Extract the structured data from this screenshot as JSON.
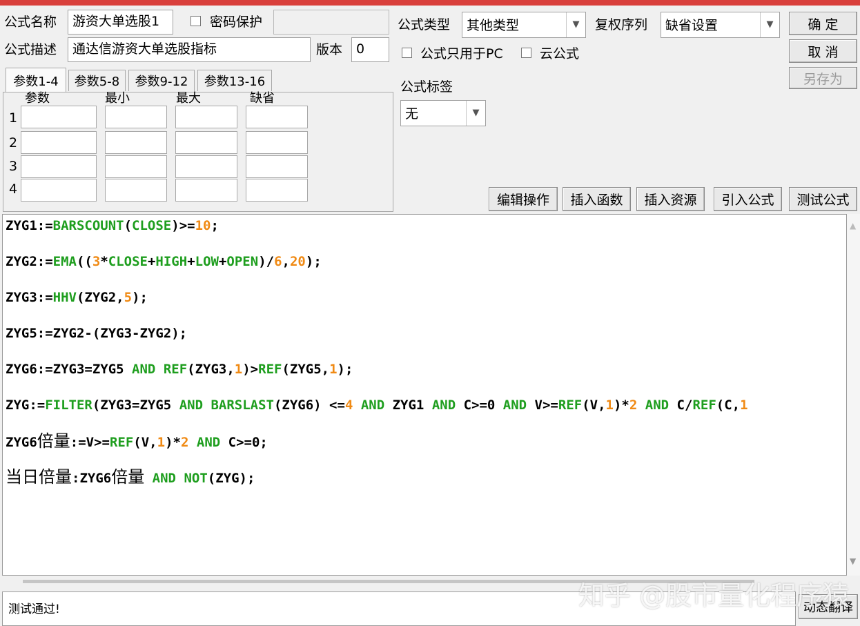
{
  "header": {
    "name_label": "公式名称",
    "name_value": "游资大单选股1",
    "password_label": "密码保护",
    "desc_label": "公式描述",
    "desc_value": "通达信游资大单选股指标",
    "version_label": "版本",
    "version_value": "0",
    "type_label": "公式类型",
    "type_value": "其他类型",
    "rights_label": "复权序列",
    "rights_value": "缺省设置",
    "pc_only_label": "公式只用于PC",
    "cloud_label": "云公式",
    "tag_label": "公式标签",
    "tag_value": "无"
  },
  "buttons": {
    "ok": "确 定",
    "cancel": "取 消",
    "save_as": "另存为",
    "edit_ops": "编辑操作",
    "insert_func": "插入函数",
    "insert_res": "插入资源",
    "import_formula": "引入公式",
    "test_formula": "测试公式",
    "dynamic_translate": "动态翻译"
  },
  "params": {
    "tabs": [
      "参数1-4",
      "参数5-8",
      "参数9-12",
      "参数13-16"
    ],
    "columns": [
      "参数",
      "最小",
      "最大",
      "缺省"
    ],
    "rows": [
      "1",
      "2",
      "3",
      "4"
    ]
  },
  "code": {
    "l1": {
      "a": "ZYG1:=",
      "b": "BARSCOUNT",
      "c": "(",
      "d": "CLOSE",
      "e": ")>=",
      "f": "10",
      "g": ";"
    },
    "l2": {
      "a": "ZYG2:=",
      "b": "EMA",
      "c": "((",
      "d": "3",
      "e": "*",
      "f": "CLOSE",
      "g": "+",
      "h": "HIGH",
      "i": "+",
      "j": "LOW",
      "k": "+",
      "l": "OPEN",
      "m": ")/",
      "n": "6",
      "o": ",",
      "p": "20",
      "q": ");"
    },
    "l3": {
      "a": "ZYG3:=",
      "b": "HHV",
      "c": "(ZYG2,",
      "d": "5",
      "e": ");"
    },
    "l4": {
      "a": "ZYG5:=ZYG2-(ZYG3-ZYG2);"
    },
    "l5": {
      "a": "ZYG6:=ZYG3=ZYG5 ",
      "b": "AND",
      "c": " ",
      "d": "REF",
      "e": "(ZYG3,",
      "f": "1",
      "g": ")>",
      "h": "REF",
      "i": "(ZYG5,",
      "j": "1",
      "k": ");"
    },
    "l6": {
      "a": "ZYG:=",
      "b": "FILTER",
      "c": "(ZYG3=ZYG5 ",
      "d": "AND",
      "e": " ",
      "f": "BARSLAST",
      "g": "(ZYG6) <=",
      "h": "4",
      "i": " ",
      "j": "AND",
      "k": " ZYG1 ",
      "l": "AND",
      "m": " C>=0 ",
      "n": "AND",
      "o": " V>=",
      "p": "REF",
      "q": "(V,",
      "r": "1",
      "s": ")*",
      "t": "2",
      "u": " ",
      "v": "AND",
      "w": " C/",
      "x": "REF",
      "y": "(C,",
      "z": "1"
    },
    "l7": {
      "a": "ZYG6",
      "b": "倍量",
      "c": ":=V>=",
      "d": "REF",
      "e": "(V,",
      "f": "1",
      "g": ")*",
      "h": "2",
      "i": " ",
      "j": "AND",
      "k": " C>=0;"
    },
    "l8": {
      "a": "当日倍量",
      "b": ":ZYG6",
      "c": "倍量",
      "d": " ",
      "e": "AND",
      "f": " ",
      "g": "NOT",
      "h": "(ZYG);"
    }
  },
  "status": {
    "text": "测试通过!"
  },
  "watermark": "知乎 @股市量化程序猿",
  "colors": {
    "keyword": "#1e9e1e",
    "number": "#f08a14",
    "titlebar": "#d9403c"
  }
}
